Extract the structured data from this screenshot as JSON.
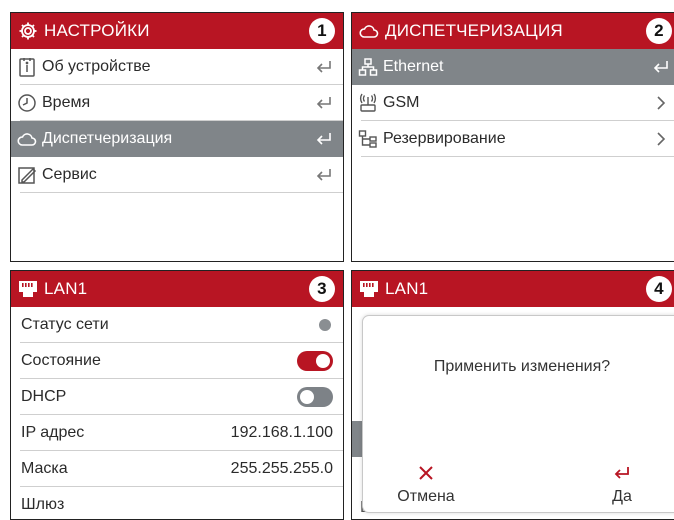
{
  "colors": {
    "header": "#b81523",
    "selected_row": "#808589",
    "toggle_off": "#7d8287",
    "status_dot": "#8a8e92"
  },
  "panel1": {
    "title": "НАСТРОЙКИ",
    "number": "1",
    "items": [
      {
        "label": "Об устройстве",
        "icon": "info-icon"
      },
      {
        "label": "Время",
        "icon": "clock-icon"
      },
      {
        "label": "Диспетчеризация",
        "icon": "cloud-icon",
        "selected": true
      },
      {
        "label": "Сервис",
        "icon": "service-icon"
      }
    ]
  },
  "panel2": {
    "title": "ДИСПЕТЧЕРИЗАЦИЯ",
    "number": "2",
    "items": [
      {
        "label": "Ethernet",
        "icon": "network-icon",
        "selected": true
      },
      {
        "label": "GSM",
        "icon": "gsm-icon"
      },
      {
        "label": "Резервирование",
        "icon": "reserve-icon"
      }
    ]
  },
  "panel3": {
    "title": "LAN1",
    "number": "3",
    "rows": [
      {
        "label": "Статус сети"
      },
      {
        "label": "Состояние",
        "toggle": "on"
      },
      {
        "label": "DHCP",
        "toggle": "off"
      },
      {
        "label": "IP адрес",
        "value": "192.168.1.100"
      },
      {
        "label": "Маска",
        "value": "255.255.255.0"
      },
      {
        "label": "Шлюз"
      }
    ]
  },
  "panel4": {
    "title": "LAN1",
    "number": "4",
    "under_text": "Шлюз",
    "dialog": {
      "question": "Применить изменения?",
      "cancel": "Отмена",
      "confirm": "Да"
    }
  }
}
